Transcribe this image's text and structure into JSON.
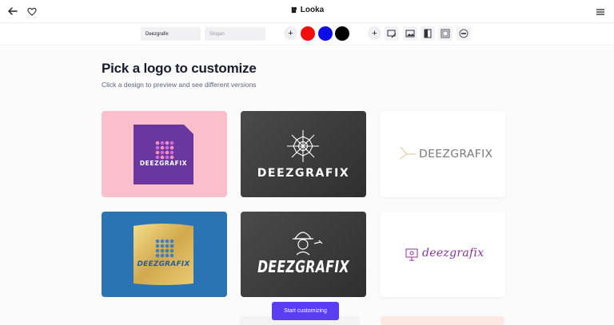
{
  "header": {
    "brand_name": "Looka",
    "back_icon": "arrow-left-icon",
    "favorite_icon": "heart-icon",
    "menu_icon": "hamburger-menu-icon"
  },
  "toolbar": {
    "company_name_value": "Deezgrafix",
    "slogan_placeholder": "Slogan",
    "add_color_icon": "plus-icon",
    "colors": [
      "#f20d0d",
      "#0d0de8",
      "#000000"
    ],
    "add_symbol_icon": "plus-icon",
    "tool_icons": [
      "image-edit-icon",
      "image-icon",
      "layout-icon",
      "picture-frame-icon",
      "badge-icon"
    ]
  },
  "main": {
    "title": "Pick a logo to customize",
    "subtitle": "Click a design to preview and see different versions",
    "cta_label": "Start customizing"
  },
  "logos": [
    {
      "text": "DEEZGRAFIX",
      "background": "#fbbfcb",
      "badge_color": "#6a36a0",
      "text_color": "#ffffff"
    },
    {
      "text": "DEEZGRAFIX",
      "background": "#3d3d3d",
      "text_color": "#ffffff"
    },
    {
      "text": "DEEZGRAFIX",
      "background": "#ffffff",
      "text_color": "#6b6b6b",
      "symbol_color": "#e8cda6"
    },
    {
      "text": "DEEZGRAFIX",
      "background": "#2a74b3",
      "text_color": "#2a5c9e",
      "badge_color": "#d6b75c"
    },
    {
      "text": "DEEZGRAFIX",
      "background": "#3d3d3d",
      "text_color": "#ffffff"
    },
    {
      "text": "deezgrafix",
      "background": "#ffffff",
      "text_color": "#8a2fa0"
    }
  ]
}
